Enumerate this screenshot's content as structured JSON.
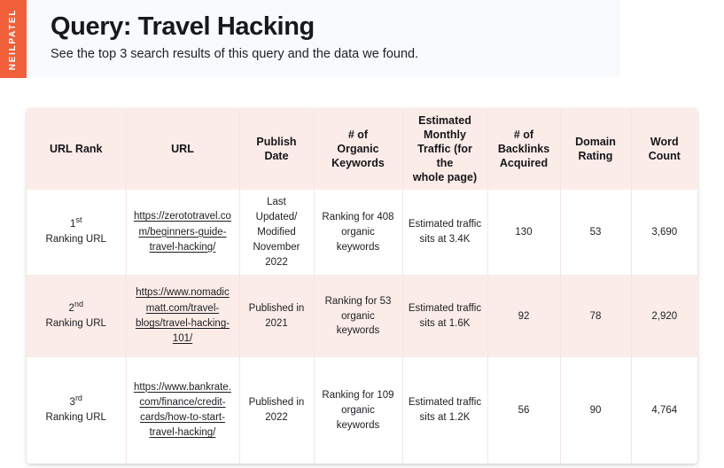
{
  "header": {
    "brand": "NEILPATEL",
    "title": "Query: Travel Hacking",
    "subtitle": "See the top 3 search results of this query and the data we found.",
    "brand_color": "#F1603A",
    "banner_bg": "#F8FAFC"
  },
  "table": {
    "header_bg": "#FCECE7",
    "columns": [
      "URL Rank",
      "URL",
      "Publish Date",
      "# of Organic Keywords",
      "Estimated Monthly Traffic (for the whole page)",
      "# of Backlinks Acquired",
      "Domain Rating",
      "Word Count"
    ],
    "columns_display": [
      "URL Rank",
      "URL",
      "Publish\nDate",
      "# of\nOrganic\nKeywords",
      "Estimated\nMonthly\nTraffic (for the\nwhole page)",
      "# of\nBacklinks\nAcquired",
      "Domain\nRating",
      "Word\nCount"
    ],
    "rows": [
      {
        "rank_number": "1",
        "rank_ordinal": "st",
        "rank_label": "Ranking URL",
        "url": "https://zerototravel.com/beginners-guide-travel-hacking/",
        "publish_date": "Last Updated/ Modified November 2022",
        "organic_keywords": "Ranking for 408 organic keywords",
        "monthly_traffic": "Estimated traffic sits at 3.4K",
        "backlinks": "130",
        "domain_rating": "53",
        "word_count": "3,690"
      },
      {
        "rank_number": "2",
        "rank_ordinal": "nd",
        "rank_label": "Ranking URL",
        "url": "https://www.nomadicmatt.com/travel-blogs/travel-hacking-101/",
        "publish_date": "Published in 2021",
        "organic_keywords": "Ranking for 53 organic keywords",
        "monthly_traffic": "Estimated traffic sits at 1.6K",
        "backlinks": "92",
        "domain_rating": "78",
        "word_count": "2,920"
      },
      {
        "rank_number": "3",
        "rank_ordinal": "rd",
        "rank_label": "Ranking URL",
        "url": "https://www.bankrate.com/finance/credit-cards/how-to-start-travel-hacking/",
        "publish_date": "Published in 2022",
        "organic_keywords": "Ranking for 109 organic keywords",
        "monthly_traffic": "Estimated traffic sits at 1.2K",
        "backlinks": "56",
        "domain_rating": "90",
        "word_count": "4,764"
      }
    ]
  }
}
